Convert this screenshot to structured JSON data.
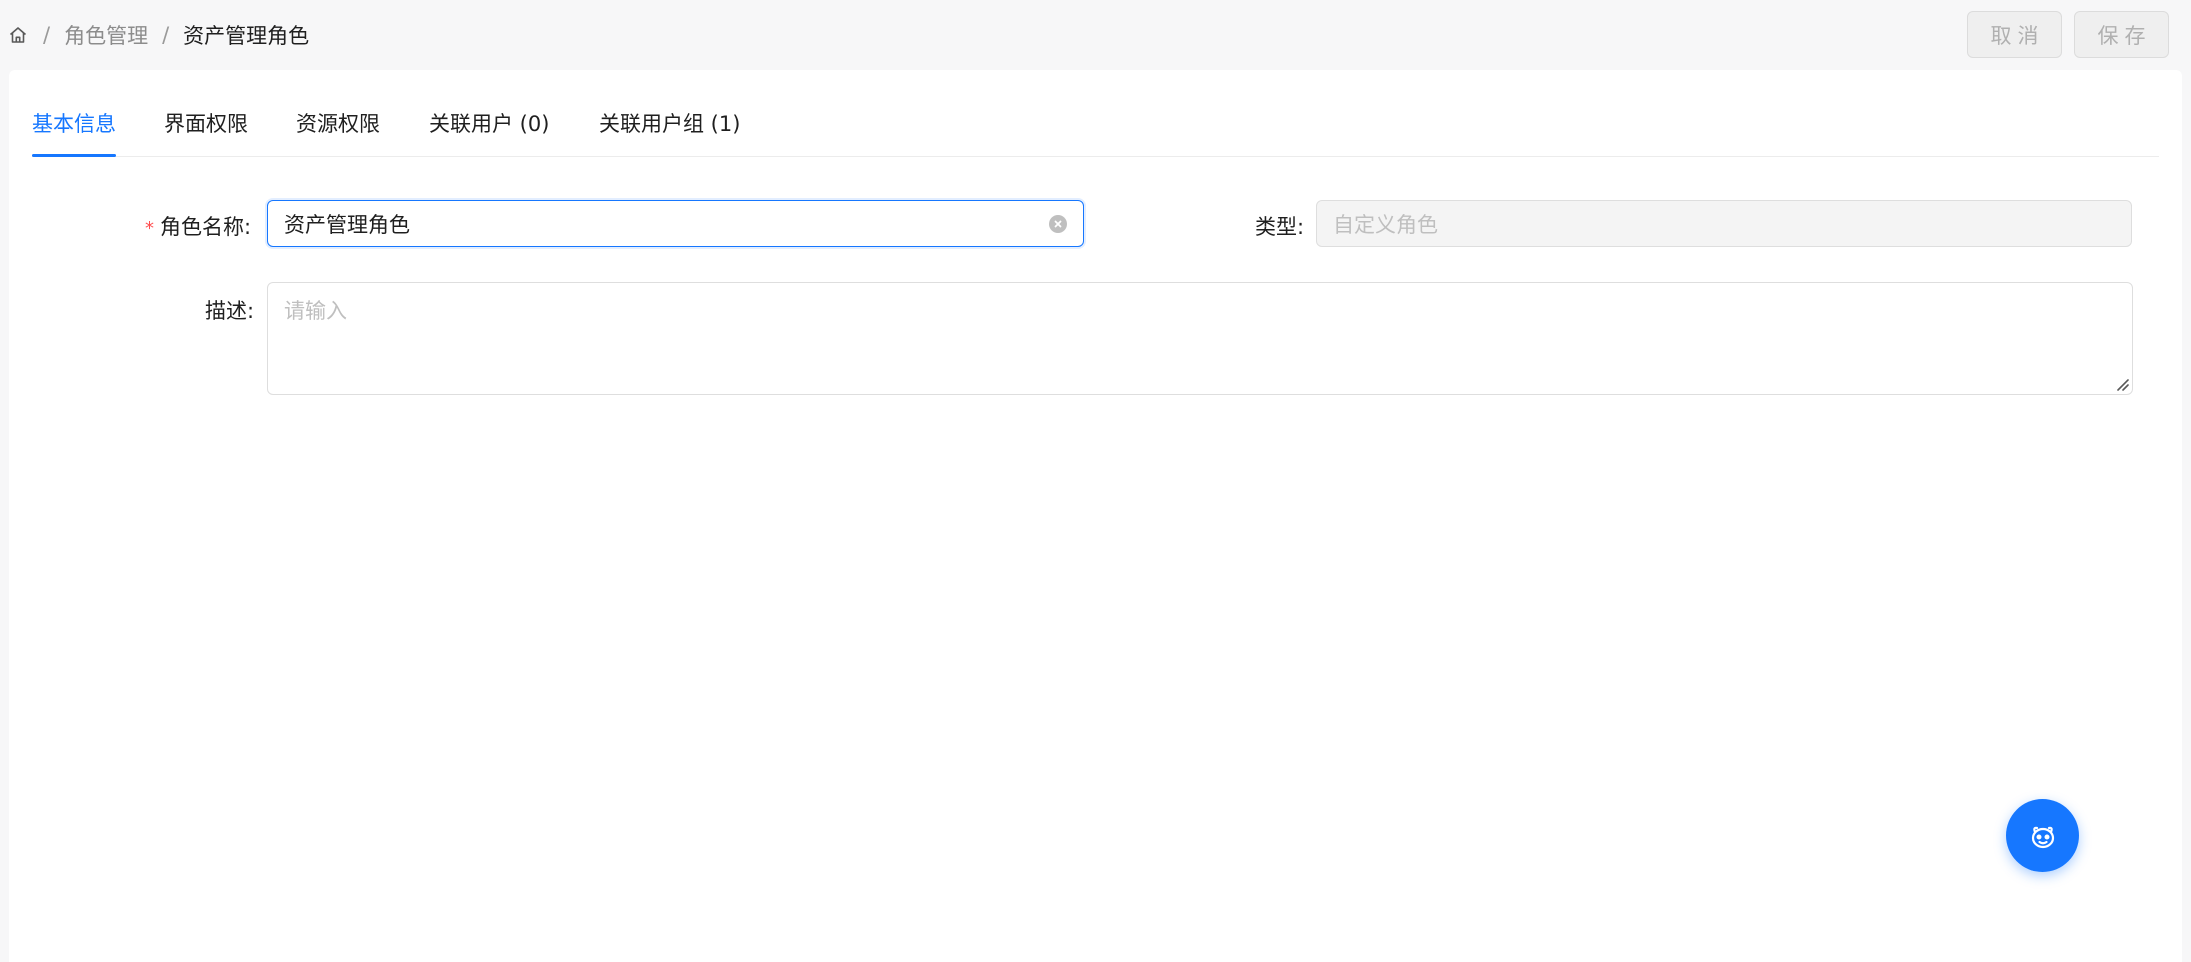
{
  "breadcrumb": {
    "home_icon": "home-icon",
    "separator": "/",
    "items": [
      "角色管理",
      "资产管理角色"
    ]
  },
  "actions": {
    "cancel_label": "取消",
    "save_label": "保存"
  },
  "tabs": [
    {
      "label": "基本信息",
      "active": true
    },
    {
      "label": "界面权限",
      "active": false
    },
    {
      "label": "资源权限",
      "active": false
    },
    {
      "label": "关联用户 (0)",
      "active": false
    },
    {
      "label": "关联用户组 (1)",
      "active": false
    }
  ],
  "form": {
    "required_mark": "*",
    "name_label": "角色名称:",
    "name_value": "资产管理角色",
    "type_label": "类型:",
    "type_placeholder": "自定义角色",
    "desc_label": "描述:",
    "desc_placeholder": "请输入"
  },
  "fab": {
    "icon": "assistant-robot-icon"
  },
  "colors": {
    "primary": "#1677ff",
    "required": "#ff4d4f"
  }
}
